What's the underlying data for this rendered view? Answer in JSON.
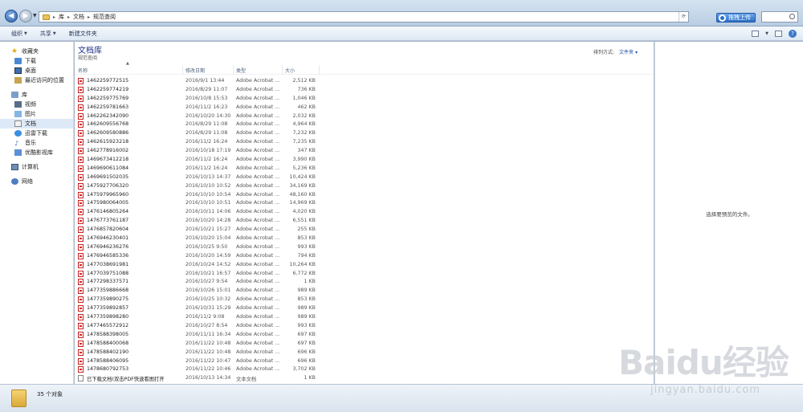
{
  "address": {
    "breadcrumbs": [
      "库",
      "文档",
      "规范查阅"
    ]
  },
  "cloud_button": {
    "label": "拖拽上传"
  },
  "toolbar": {
    "organize_label": "组织",
    "share_label": "共享",
    "new_folder_label": "新建文件夹"
  },
  "sidebar": {
    "favorites": "收藏夹",
    "fav_items": [
      "下载",
      "桌面",
      "最近访问的位置"
    ],
    "libraries": "库",
    "lib_items": [
      "视频",
      "图片",
      "文档",
      "迅雷下载",
      "音乐",
      "优酷影视库"
    ],
    "computer": "计算机",
    "network": "网络"
  },
  "main": {
    "library_title": "文档库",
    "library_subtitle": "规范查阅",
    "arrange_label": "排列方式:",
    "arrange_value": "文件夹",
    "columns": {
      "name": "名称",
      "date": "修改日期",
      "type": "类型",
      "size": "大小"
    },
    "files": [
      {
        "name": "1462259772515",
        "date": "2016/9/1 13:44",
        "type": "Adobe Acrobat ...",
        "size": "2,512 KB",
        "icon": "pdf-icon"
      },
      {
        "name": "1462259774219",
        "date": "2016/8/29 11:07",
        "type": "Adobe Acrobat ...",
        "size": "736 KB",
        "icon": "pdf-icon"
      },
      {
        "name": "1462259775769",
        "date": "2016/10/8 15:53",
        "type": "Adobe Acrobat ...",
        "size": "1,046 KB",
        "icon": "pdf-icon"
      },
      {
        "name": "1462259781663",
        "date": "2016/11/2 16:23",
        "type": "Adobe Acrobat ...",
        "size": "462 KB",
        "icon": "pdf-icon"
      },
      {
        "name": "1462262342090",
        "date": "2016/10/20 14:30",
        "type": "Adobe Acrobat ...",
        "size": "2,032 KB",
        "icon": "pdf-icon"
      },
      {
        "name": "1462609556768",
        "date": "2016/8/29 11:08",
        "type": "Adobe Acrobat ...",
        "size": "4,964 KB",
        "icon": "pdf-icon"
      },
      {
        "name": "1462609580886",
        "date": "2016/8/29 11:08",
        "type": "Adobe Acrobat ...",
        "size": "7,232 KB",
        "icon": "pdf-icon"
      },
      {
        "name": "1462615923218",
        "date": "2016/11/2 16:24",
        "type": "Adobe Acrobat ...",
        "size": "7,235 KB",
        "icon": "pdf-icon"
      },
      {
        "name": "1462778916002",
        "date": "2016/10/18 17:19",
        "type": "Adobe Acrobat ...",
        "size": "347 KB",
        "icon": "pdf-icon"
      },
      {
        "name": "1469673412218",
        "date": "2016/11/2 16:24",
        "type": "Adobe Acrobat ...",
        "size": "3,990 KB",
        "icon": "pdf-icon"
      },
      {
        "name": "1469690611084",
        "date": "2016/11/2 16:24",
        "type": "Adobe Acrobat ...",
        "size": "5,236 KB",
        "icon": "pdf-icon"
      },
      {
        "name": "1469691502035",
        "date": "2016/10/13 14:37",
        "type": "Adobe Acrobat ...",
        "size": "10,424 KB",
        "icon": "pdf-icon"
      },
      {
        "name": "1475927706320",
        "date": "2016/10/10 10:52",
        "type": "Adobe Acrobat ...",
        "size": "34,169 KB",
        "icon": "pdf-icon"
      },
      {
        "name": "1475979965960",
        "date": "2016/10/10 10:54",
        "type": "Adobe Acrobat ...",
        "size": "48,160 KB",
        "icon": "pdf-icon"
      },
      {
        "name": "1475980064005",
        "date": "2016/10/10 10:51",
        "type": "Adobe Acrobat ...",
        "size": "14,969 KB",
        "icon": "pdf-icon"
      },
      {
        "name": "1476146805264",
        "date": "2016/10/11 14:06",
        "type": "Adobe Acrobat ...",
        "size": "4,020 KB",
        "icon": "pdf-icon"
      },
      {
        "name": "1476773761187",
        "date": "2016/10/20 14:28",
        "type": "Adobe Acrobat ...",
        "size": "6,551 KB",
        "icon": "pdf-icon"
      },
      {
        "name": "1476857820604",
        "date": "2016/10/21 15:27",
        "type": "Adobe Acrobat ...",
        "size": "255 KB",
        "icon": "pdf-icon"
      },
      {
        "name": "1476946230401",
        "date": "2016/10/20 15:04",
        "type": "Adobe Acrobat ...",
        "size": "853 KB",
        "icon": "pdf-icon"
      },
      {
        "name": "1476946236276",
        "date": "2016/10/25 9:50",
        "type": "Adobe Acrobat ...",
        "size": "993 KB",
        "icon": "pdf-icon"
      },
      {
        "name": "1476946585336",
        "date": "2016/10/20 14:59",
        "type": "Adobe Acrobat ...",
        "size": "794 KB",
        "icon": "pdf-icon"
      },
      {
        "name": "1477038691981",
        "date": "2016/10/24 14:52",
        "type": "Adobe Acrobat ...",
        "size": "10,264 KB",
        "icon": "pdf-icon"
      },
      {
        "name": "1477039751088",
        "date": "2016/10/21 16:57",
        "type": "Adobe Acrobat ...",
        "size": "6,772 KB",
        "icon": "pdf-icon"
      },
      {
        "name": "1477298337571",
        "date": "2016/10/27 9:54",
        "type": "Adobe Acrobat ...",
        "size": "1 KB",
        "icon": "pdf-icon"
      },
      {
        "name": "1477359886668",
        "date": "2016/10/26 15:01",
        "type": "Adobe Acrobat ...",
        "size": "989 KB",
        "icon": "pdf-icon"
      },
      {
        "name": "1477359890275",
        "date": "2016/10/25 10:32",
        "type": "Adobe Acrobat ...",
        "size": "853 KB",
        "icon": "pdf-icon"
      },
      {
        "name": "1477359892857",
        "date": "2016/10/31 15:29",
        "type": "Adobe Acrobat ...",
        "size": "989 KB",
        "icon": "pdf-icon"
      },
      {
        "name": "1477359898280",
        "date": "2016/11/2 9:08",
        "type": "Adobe Acrobat ...",
        "size": "989 KB",
        "icon": "pdf-icon"
      },
      {
        "name": "1477465572912",
        "date": "2016/10/27 8:54",
        "type": "Adobe Acrobat ...",
        "size": "993 KB",
        "icon": "pdf-icon"
      },
      {
        "name": "1478588398005",
        "date": "2016/11/11 16:34",
        "type": "Adobe Acrobat ...",
        "size": "697 KB",
        "icon": "pdf-icon"
      },
      {
        "name": "1478588400068",
        "date": "2016/11/22 10:48",
        "type": "Adobe Acrobat ...",
        "size": "697 KB",
        "icon": "pdf-icon"
      },
      {
        "name": "1478588402190",
        "date": "2016/11/22 10:48",
        "type": "Adobe Acrobat ...",
        "size": "696 KB",
        "icon": "pdf-icon"
      },
      {
        "name": "1478588406095",
        "date": "2016/11/22 10:47",
        "type": "Adobe Acrobat ...",
        "size": "696 KB",
        "icon": "pdf-icon"
      },
      {
        "name": "1478680792753",
        "date": "2016/11/22 10:46",
        "type": "Adobe Acrobat ...",
        "size": "3,702 KB",
        "icon": "pdf-icon"
      },
      {
        "name": "已下载文档(双击PDF快速看图打开",
        "date": "2016/10/13 14:34",
        "type": "文本文档",
        "size": "1 KB",
        "icon": "txt-icon"
      }
    ]
  },
  "preview": {
    "empty_text": "选择要预览的文件。"
  },
  "status": {
    "count_text": "35 个对象"
  },
  "watermark": {
    "logo_text": "Baidu经验",
    "url": "jingyan.baidu.com"
  }
}
